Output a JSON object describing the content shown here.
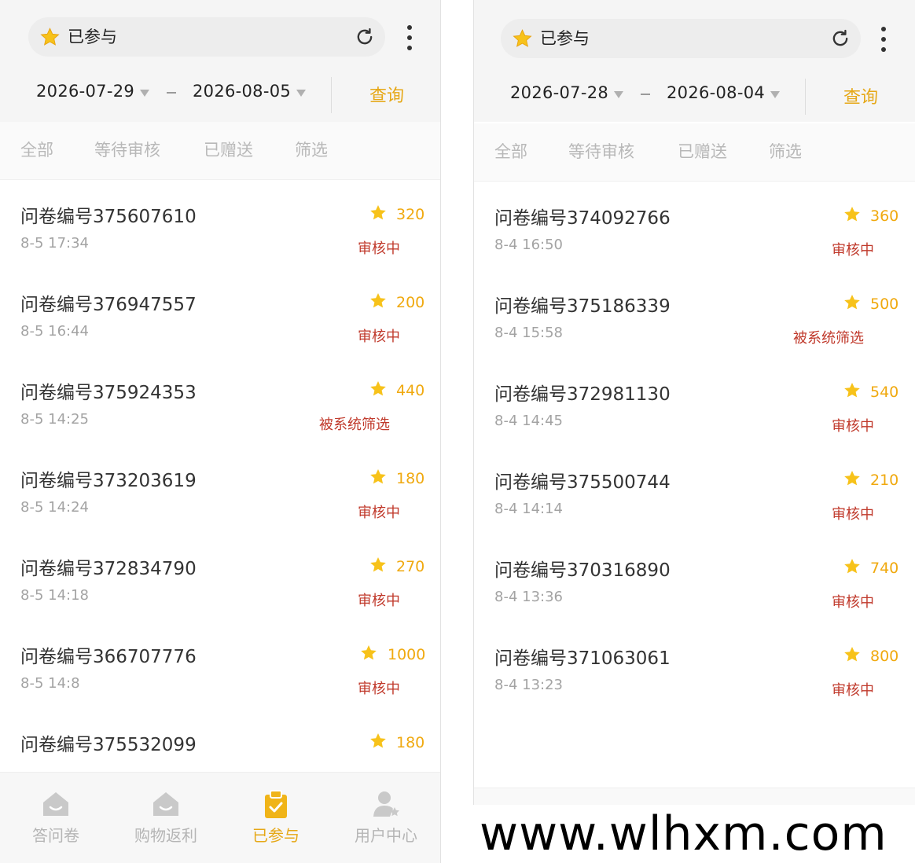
{
  "colors": {
    "accent": "#e6a817",
    "points": "#f0a90f",
    "status_red": "#c0392b"
  },
  "left": {
    "title": "已参与",
    "date_start": "2026-07-29",
    "date_end": "2026-08-05",
    "query_label": "查询",
    "tabs": [
      "全部",
      "等待审核",
      "已赠送",
      "筛选"
    ],
    "items": [
      {
        "id": "问卷编号375607610",
        "time": "8-5 17:34",
        "points": "320",
        "status": "审核中"
      },
      {
        "id": "问卷编号376947557",
        "time": "8-5 16:44",
        "points": "200",
        "status": "审核中"
      },
      {
        "id": "问卷编号375924353",
        "time": "8-5 14:25",
        "points": "440",
        "status": "被系统筛选"
      },
      {
        "id": "问卷编号373203619",
        "time": "8-5 14:24",
        "points": "180",
        "status": "审核中"
      },
      {
        "id": "问卷编号372834790",
        "time": "8-5 14:18",
        "points": "270",
        "status": "审核中"
      },
      {
        "id": "问卷编号366707776",
        "time": "8-5 14:8",
        "points": "1000",
        "status": "审核中"
      },
      {
        "id": "问卷编号375532099",
        "time": "",
        "points": "180",
        "status": ""
      }
    ],
    "nav": [
      "答问卷",
      "购物返利",
      "已参与",
      "用户中心"
    ]
  },
  "right": {
    "title": "已参与",
    "date_start": "2026-07-28",
    "date_end": "2026-08-04",
    "query_label": "查询",
    "tabs": [
      "全部",
      "等待审核",
      "已赠送",
      "筛选"
    ],
    "items": [
      {
        "id": "问卷编号374092766",
        "time": "8-4 16:50",
        "points": "360",
        "status": "审核中"
      },
      {
        "id": "问卷编号375186339",
        "time": "8-4 15:58",
        "points": "500",
        "status": "被系统筛选"
      },
      {
        "id": "问卷编号372981130",
        "time": "8-4 14:45",
        "points": "540",
        "status": "审核中"
      },
      {
        "id": "问卷编号375500744",
        "time": "8-4 14:14",
        "points": "210",
        "status": "审核中"
      },
      {
        "id": "问卷编号370316890",
        "time": "8-4 13:36",
        "points": "740",
        "status": "审核中"
      },
      {
        "id": "问卷编号371063061",
        "time": "8-4 13:23",
        "points": "800",
        "status": "审核中"
      }
    ]
  },
  "watermark": "www.wlhxm.com"
}
